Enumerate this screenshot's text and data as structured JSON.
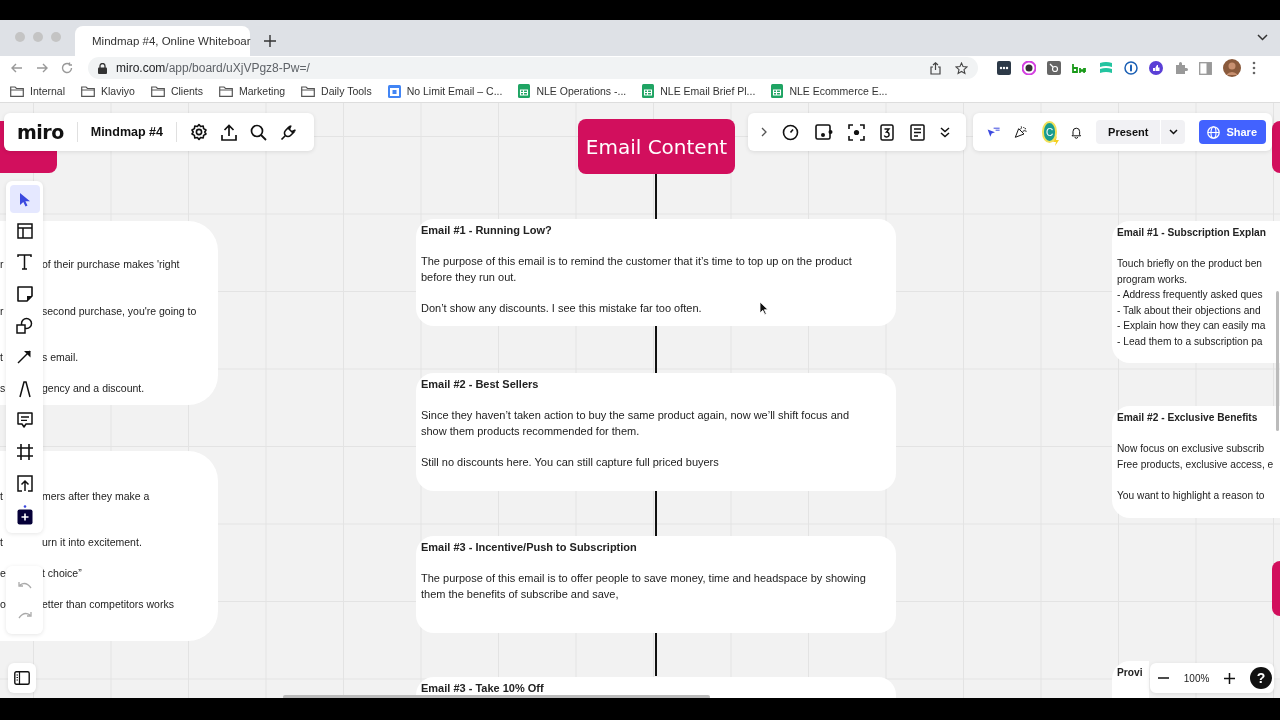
{
  "browser": {
    "tabs": [
      {
        "title": "Mindmap #4, Online Whiteboar",
        "selected": true
      }
    ],
    "url_host": "miro.com",
    "url_path": "/app/board/uXjVPgz8-Pw=/",
    "bookmarks": [
      {
        "label": "Internal",
        "kind": "folder"
      },
      {
        "label": "Klaviyo",
        "kind": "folder"
      },
      {
        "label": "Clients",
        "kind": "folder"
      },
      {
        "label": "Marketing",
        "kind": "folder"
      },
      {
        "label": "Daily Tools",
        "kind": "folder"
      },
      {
        "label": "No Limit Email – C...",
        "kind": "calendar"
      },
      {
        "label": "NLE Operations -...",
        "kind": "sheet"
      },
      {
        "label": "NLE Email Brief Pl...",
        "kind": "sheet"
      },
      {
        "label": "NLE Ecommerce E...",
        "kind": "sheet"
      }
    ]
  },
  "board": {
    "logo": "miro",
    "title": "Mindmap #4",
    "avatar": "C",
    "present": "Present",
    "share": "Share",
    "zoom": "100%",
    "help": "?",
    "tools": [
      {
        "kind": "select",
        "selected": true
      },
      {
        "kind": "templates",
        "selected": false
      },
      {
        "kind": "text",
        "selected": false
      },
      {
        "kind": "sticky",
        "selected": false
      },
      {
        "kind": "shapes",
        "selected": false
      },
      {
        "kind": "line",
        "selected": false
      },
      {
        "kind": "pen",
        "selected": false
      },
      {
        "kind": "comment",
        "selected": false
      },
      {
        "kind": "frame",
        "selected": false
      },
      {
        "kind": "upload",
        "selected": false
      },
      {
        "kind": "more",
        "selected": false
      }
    ],
    "history": [
      {
        "kind": "undo",
        "disabled": true
      },
      {
        "kind": "redo",
        "disabled": true
      }
    ]
  },
  "central_topic": "Email Content",
  "left_cards": [
    {
      "lines": [
        {
          "left": "r",
          "right": "of their purchase makes 'right"
        },
        {
          "left": "r",
          "right": "second purchase, you're going to"
        },
        {
          "left": "t",
          "right": "s email."
        },
        {
          "left": "s",
          "right": "gency and a discount."
        }
      ]
    },
    {
      "lines": [
        {
          "left": "t",
          "right": "mers after they make a"
        },
        {
          "left": "t",
          "right": "urn it into excitement."
        },
        {
          "left": "e",
          "right": "t choice”"
        },
        {
          "left": "o",
          "right": "etter than competitors works"
        }
      ]
    }
  ],
  "center_cards": [
    {
      "title": "Email #1 - Running Low?",
      "paragraphs": [
        [
          "The purpose of this email is to remind the customer that it’s time to top up on the product",
          "before they run out."
        ],
        [
          "Don’t show any discounts. I see this mistake far too often."
        ]
      ]
    },
    {
      "title": "Email #2 - Best Sellers",
      "paragraphs": [
        [
          "Since they haven’t taken action to buy the same product again, now we’ll shift focus and",
          "show them products recommended for them."
        ],
        [
          "Still no discounts here. You can still capture full priced buyers"
        ]
      ]
    },
    {
      "title": "Email #3 - Incentive/Push to Subscription",
      "paragraphs": [
        [
          "The purpose of this email is to offer people to save money, time and headspace by showing",
          "them the benefits of subscribe and save,"
        ]
      ]
    },
    {
      "title": "Email #3 - Take 10% Off"
    }
  ],
  "right_cards": [
    {
      "title": "Email #1 - Subscription Explan",
      "paragraphs": [
        [
          "Touch briefly on the product ben",
          "program works.",
          "- Address frequently asked ques",
          "- Talk about their objections and",
          "- Explain how they can easily ma",
          "- Lead them to a subscription pa"
        ]
      ]
    },
    {
      "title": "Email #2 - Exclusive Benefits",
      "paragraphs": [
        [
          "Now focus on exclusive subscrib",
          "Free products, exclusive access, e"
        ],
        [
          "You want to highlight a reason to"
        ]
      ]
    },
    {
      "title": "Provi"
    }
  ]
}
